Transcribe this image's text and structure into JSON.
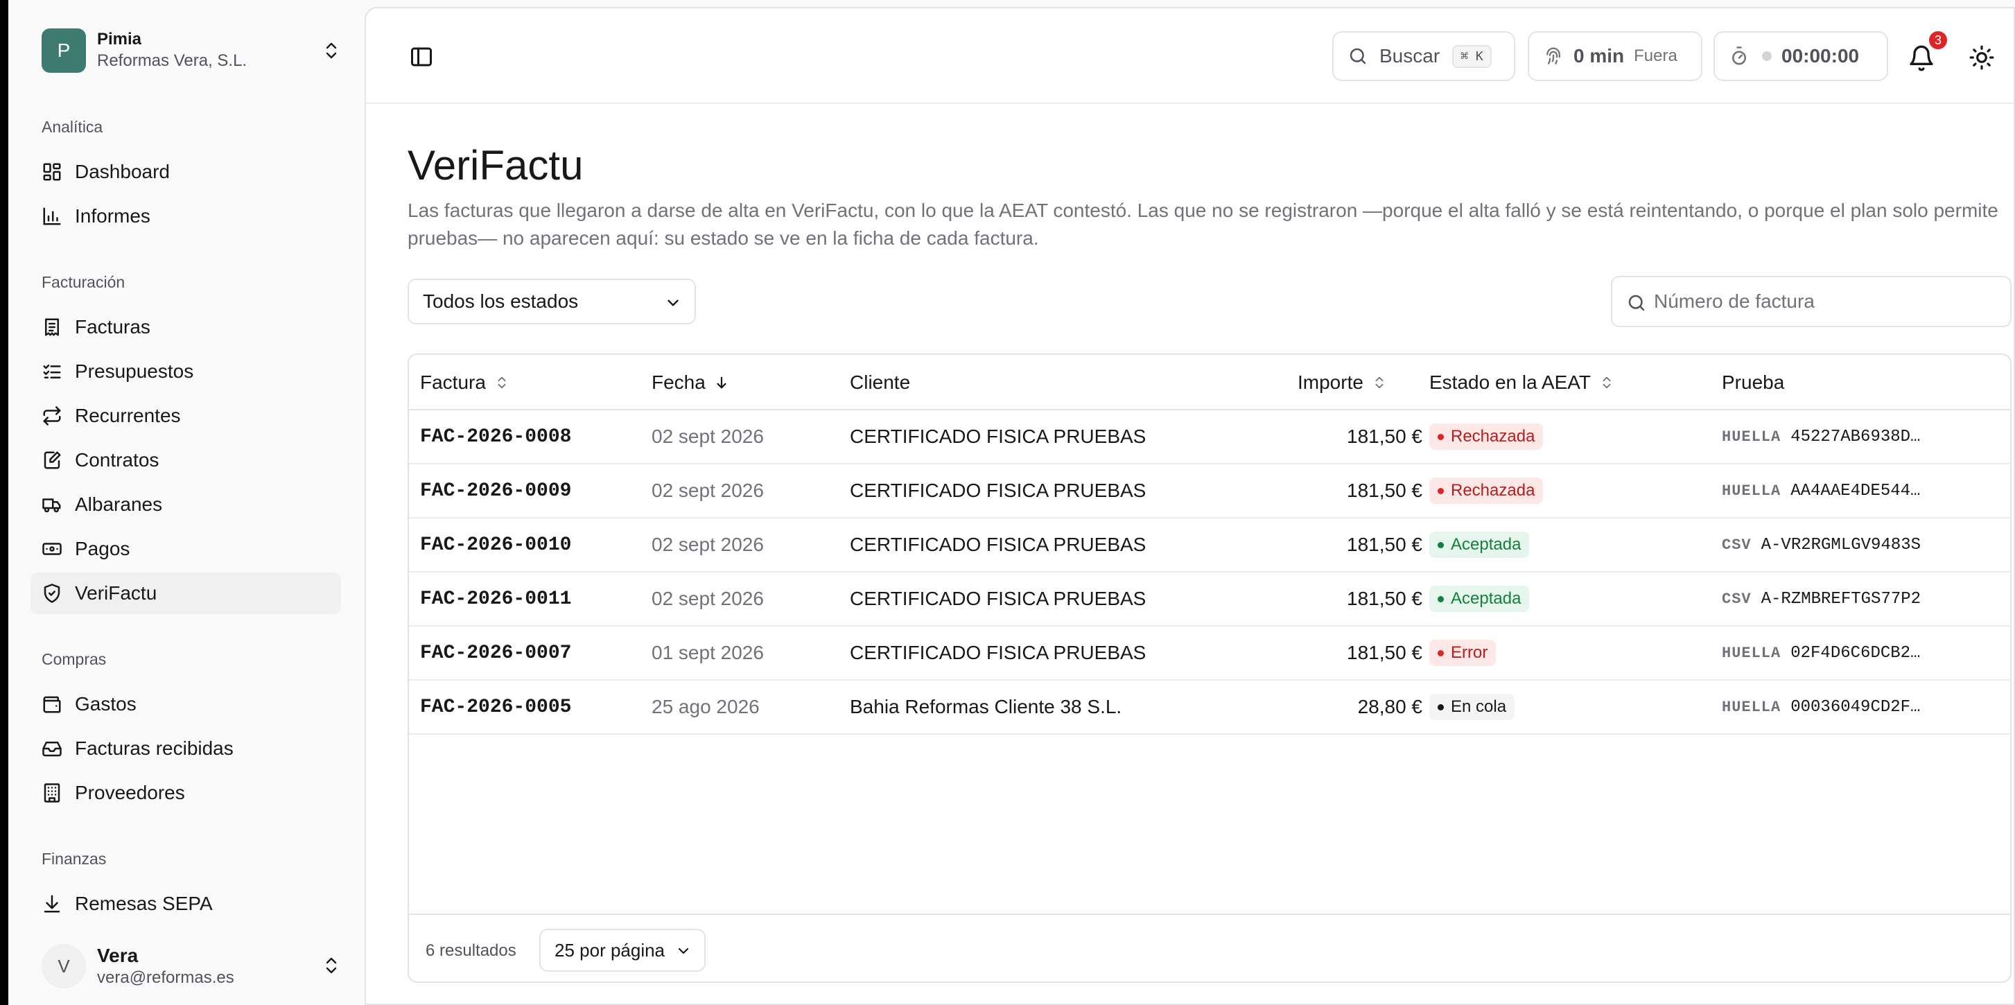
{
  "org": {
    "initial": "P",
    "name": "Pimia",
    "subtitle": "Reformas Vera, S.L."
  },
  "sidebar": {
    "sections": [
      {
        "title": "Analítica"
      },
      {
        "title": "Facturación"
      },
      {
        "title": "Compras"
      },
      {
        "title": "Finanzas"
      }
    ],
    "items": [
      {
        "label": "Dashboard",
        "icon": "dashboard-icon"
      },
      {
        "label": "Informes",
        "icon": "chart-icon"
      },
      {
        "label": "Facturas",
        "icon": "invoice-icon"
      },
      {
        "label": "Presupuestos",
        "icon": "checklist-icon"
      },
      {
        "label": "Recurrentes",
        "icon": "repeat-icon"
      },
      {
        "label": "Contratos",
        "icon": "contract-icon"
      },
      {
        "label": "Albaranes",
        "icon": "truck-icon"
      },
      {
        "label": "Pagos",
        "icon": "banknote-icon"
      },
      {
        "label": "VeriFactu",
        "icon": "shield-check-icon",
        "active": true
      },
      {
        "label": "Gastos",
        "icon": "wallet-icon"
      },
      {
        "label": "Facturas recibidas",
        "icon": "inbox-icon"
      },
      {
        "label": "Proveedores",
        "icon": "building-icon"
      },
      {
        "label": "Remesas SEPA",
        "icon": "download-icon"
      }
    ]
  },
  "user": {
    "initial": "V",
    "name": "Vera",
    "email": "vera@reformas.es"
  },
  "topbar": {
    "search_label": "Buscar",
    "search_kbd": "⌘ K",
    "time_value": "0 min",
    "time_status": "Fuera",
    "timer": "00:00:00",
    "notifications_count": "3"
  },
  "page": {
    "title": "VeriFactu",
    "description": "Las facturas que llegaron a darse de alta en VeriFactu, con lo que la AEAT contestó. Las que no se registraron —porque el alta falló y se está reintentando, o porque el plan solo permite pruebas— no aparecen aquí: su estado se ve en la ficha de cada factura.",
    "filter_selected": "Todos los estados",
    "invoice_search_placeholder": "Número de factura"
  },
  "table": {
    "headers": {
      "invoice": "Factura",
      "date": "Fecha",
      "client": "Cliente",
      "amount": "Importe",
      "status": "Estado en la AEAT",
      "proof": "Prueba"
    },
    "rows": [
      {
        "invoice": "FAC-2026-0008",
        "date": "02 sept 2026",
        "client": "CERTIFICADO FISICA PRUEBAS",
        "amount": "181,50 €",
        "status": "Rechazada",
        "status_kind": "rej",
        "proof_label": "HUELLA",
        "proof_value": "45227AB6938D…"
      },
      {
        "invoice": "FAC-2026-0009",
        "date": "02 sept 2026",
        "client": "CERTIFICADO FISICA PRUEBAS",
        "amount": "181,50 €",
        "status": "Rechazada",
        "status_kind": "rej",
        "proof_label": "HUELLA",
        "proof_value": "AA4AAE4DE544…"
      },
      {
        "invoice": "FAC-2026-0010",
        "date": "02 sept 2026",
        "client": "CERTIFICADO FISICA PRUEBAS",
        "amount": "181,50 €",
        "status": "Aceptada",
        "status_kind": "acc",
        "proof_label": "CSV",
        "proof_value": "A-VR2RGMLGV9483S"
      },
      {
        "invoice": "FAC-2026-0011",
        "date": "02 sept 2026",
        "client": "CERTIFICADO FISICA PRUEBAS",
        "amount": "181,50 €",
        "status": "Aceptada",
        "status_kind": "acc",
        "proof_label": "CSV",
        "proof_value": "A-RZMBREFTGS77P2"
      },
      {
        "invoice": "FAC-2026-0007",
        "date": "01 sept 2026",
        "client": "CERTIFICADO FISICA PRUEBAS",
        "amount": "181,50 €",
        "status": "Error",
        "status_kind": "rej",
        "proof_label": "HUELLA",
        "proof_value": "02F4D6C6DCB2…"
      },
      {
        "invoice": "FAC-2026-0005",
        "date": "25 ago 2026",
        "client": "Bahia Reformas Cliente 38 S.L.",
        "amount": "28,80 €",
        "status": "En cola",
        "status_kind": "q",
        "proof_label": "HUELLA",
        "proof_value": "00036049CD2F…"
      }
    ],
    "results": "6 resultados",
    "per_page": "25 por página"
  },
  "colors": {
    "brand": "#3d7a70",
    "danger": "#dc2626",
    "success": "#15803d"
  }
}
